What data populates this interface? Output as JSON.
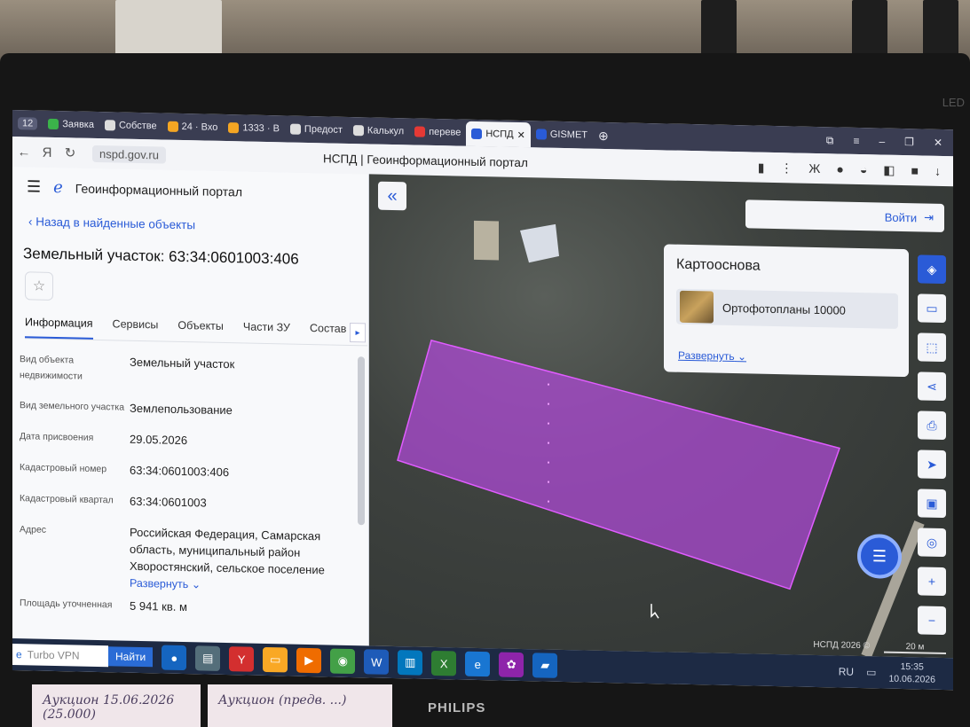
{
  "browser": {
    "tab_counter": "12",
    "tabs": [
      {
        "label": "Заявка",
        "color": "#3bb34a"
      },
      {
        "label": "Собстве",
        "color": "#dddddd"
      },
      {
        "label": "24 · Вхо",
        "color": "#f5a623"
      },
      {
        "label": "1333 · В",
        "color": "#f5a623"
      },
      {
        "label": "Предост",
        "color": "#dddddd"
      },
      {
        "label": "Калькул",
        "color": "#dddddd"
      },
      {
        "label": "переве",
        "color": "#e53935"
      },
      {
        "label": "НСПД",
        "color": "#2a5bd7",
        "active": true
      },
      {
        "label": "GISMET",
        "color": "#2a5bd7"
      }
    ],
    "url": "nspd.gov.ru",
    "page_title": "НСПД | Геоинформационный портал"
  },
  "sidebar": {
    "portal_name": "Геоинформационный портал",
    "back_link": "Назад в найденные объекты",
    "object_title": "Земельный участок: 63:34:0601003:406",
    "tabs": [
      "Информация",
      "Сервисы",
      "Объекты",
      "Части ЗУ",
      "Состав"
    ],
    "attributes": [
      {
        "key": "Вид объекта недвижимости",
        "value": "Земельный участок"
      },
      {
        "key": "Вид земельного участка",
        "value": "Землепользование"
      },
      {
        "key": "Дата присвоения",
        "value": "29.05.2026"
      },
      {
        "key": "Кадастровый номер",
        "value": "63:34:0601003:406"
      },
      {
        "key": "Кадастровый квартал",
        "value": "63:34:0601003"
      },
      {
        "key": "Адрес",
        "value": "Российская Федерация, Самарская область, муниципальный район Хворостянский, сельское поселение"
      },
      {
        "key": "Площадь уточненная",
        "value": "5 941 кв. м"
      }
    ],
    "expand_link": "Развернуть"
  },
  "map": {
    "login_label": "Войти",
    "basemap_title": "Картооснова",
    "basemap_item": "Ортофотопланы 10000",
    "basemap_expand": "Развернуть",
    "copyright": "НСПД 2026 ©",
    "scale_label": "20 м",
    "parcel_color": "#b04ad8"
  },
  "taskbar": {
    "search_text": "Turbo VPN",
    "find_button": "Найти",
    "lang": "RU",
    "time": "15:35",
    "date": "10.06.2026"
  },
  "monitor": {
    "brand": "PHILIPS",
    "led_label": "LED"
  },
  "notes": [
    "Аукцион 15.06.2026 (25.000)",
    "Аукцион (предв. ...)"
  ]
}
